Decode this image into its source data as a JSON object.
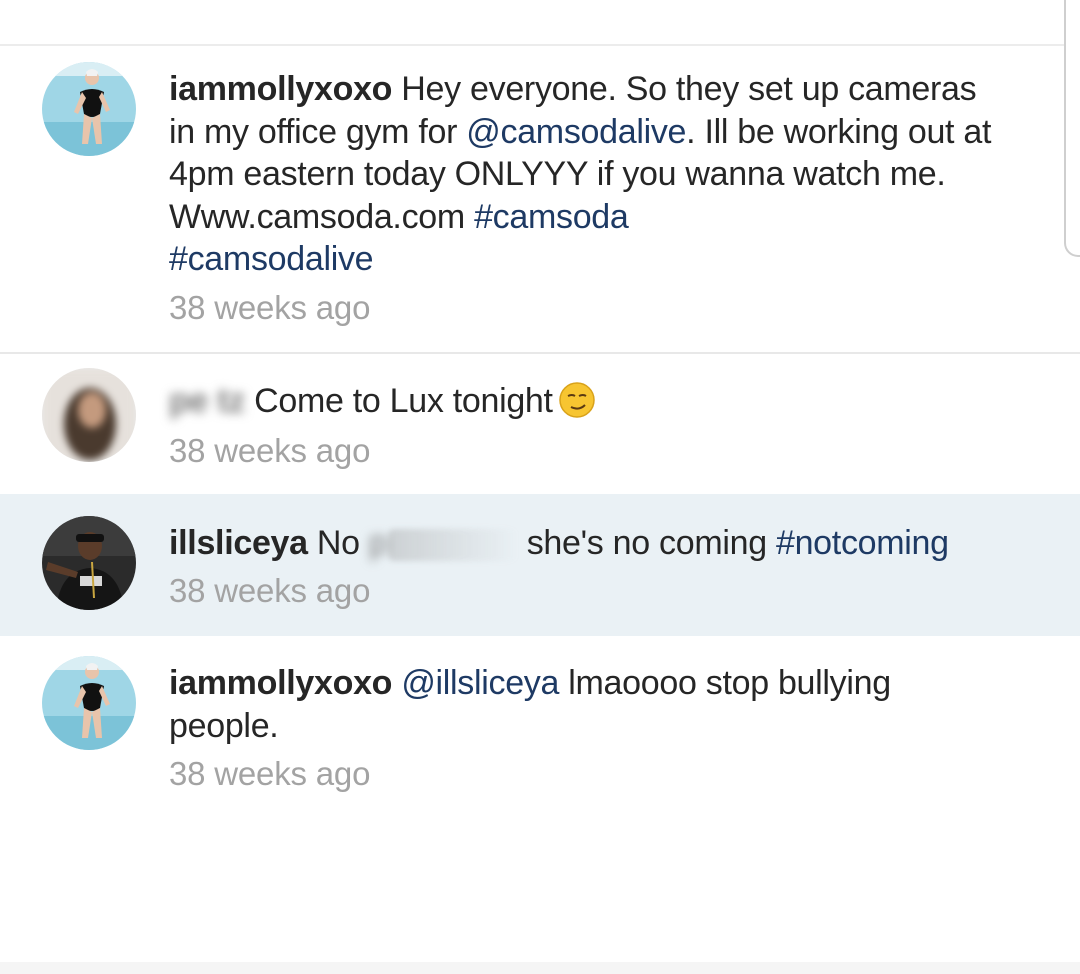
{
  "comments": [
    {
      "username": "iammollyxoxo",
      "text_1": " Hey everyone.  So they set up cameras in my office gym for ",
      "mention_1": "@camsodalive",
      "text_2": ". Ill be working out at 4pm eastern today ONLYYY  if you wanna watch me.  Www.camsoda.com ",
      "hashtag_1": "#camsoda",
      "hashtag_2": "#camsodalive",
      "time": "38 weeks ago",
      "avatar_icon": "woman-swimsuit-avatar"
    },
    {
      "username_blurred": "pe   tz",
      "text": " Come to Lux tonight",
      "emoji": "smirking-face",
      "time": "38 weeks ago",
      "avatar_icon": "blurred-avatar"
    },
    {
      "username": "illsliceya",
      "text_1": " No ",
      "redacted_left": "p",
      "text_2": " she's no coming ",
      "hashtag": "#notcoming",
      "time": "38 weeks ago",
      "avatar_icon": "man-portrait-avatar"
    },
    {
      "username": "iammollyxoxo",
      "mention": "@illsliceya",
      "text": " lmaoooo stop bullying people.",
      "time": "38 weeks ago",
      "avatar_icon": "woman-swimsuit-avatar"
    }
  ],
  "colors": {
    "text": "#262626",
    "link": "#1e3a64",
    "timestamp": "#a3a3a3",
    "highlight": "#eaf1f5"
  }
}
